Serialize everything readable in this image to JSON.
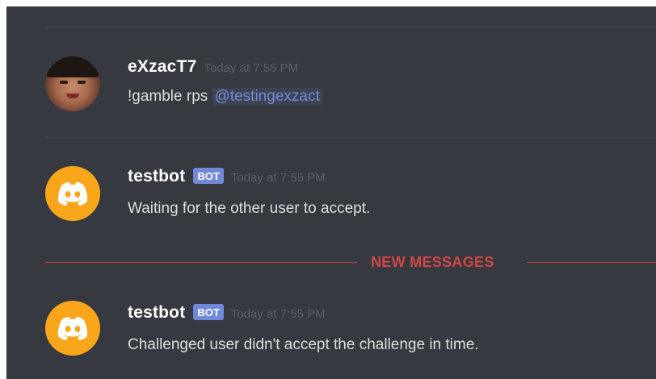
{
  "messages": [
    {
      "username": "eXzacT7",
      "timestamp": "Today at 7:55 PM",
      "text": "!gamble rps ",
      "mention": "@testingexzact",
      "avatar": "user-photo"
    },
    {
      "username": "testbot",
      "tag": "BOT",
      "timestamp": "Today at 7:55 PM",
      "text": "Waiting for the other user to accept.",
      "avatar": "discord-logo-icon"
    },
    {
      "username": "testbot",
      "tag": "BOT",
      "timestamp": "Today at 7:55 PM",
      "text": "Challenged user didn't accept the challenge in time.",
      "avatar": "discord-logo-icon"
    }
  ],
  "new_messages_label": "NEW MESSAGES",
  "colors": {
    "background": "#36393f",
    "username": "#ffffff",
    "message_text": "#dcddde",
    "timestamp": "#5c5f66",
    "mention": "#7289da",
    "bot_tag": "#7289da",
    "bot_avatar": "#faa61a",
    "new_messages": "#d14747"
  }
}
